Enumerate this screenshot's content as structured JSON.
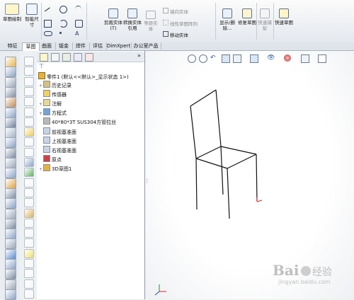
{
  "ribbon": {
    "sketch": "草图绘制",
    "smart_dim": "智能尺寸",
    "trim": "剪裁实体(T)",
    "convert": "转换实体引用",
    "offset": "等距实体",
    "mirror": "镜向实体",
    "linear_pattern": "线性草图阵列",
    "move": "移动实体",
    "show_delete": "显示/删除...",
    "repair": "修复草图",
    "quick_snap": "快速捕捉",
    "rapid_sketch": "快速草图"
  },
  "tabs": [
    "特征",
    "草图",
    "曲面",
    "钣金",
    "焊件",
    "评估",
    "DimXpert",
    "办公室产品"
  ],
  "active_tab": 1,
  "tree": {
    "root": "零件1 (默认<<默认>_显示状态 1>)",
    "items": [
      {
        "label": "历史记录",
        "expand": "+"
      },
      {
        "label": "传感器",
        "expand": ""
      },
      {
        "label": "注解",
        "expand": "+"
      },
      {
        "label": "方程式",
        "expand": "+"
      },
      {
        "label": "40*80*3T  SUS304方管拉丝",
        "expand": ""
      },
      {
        "label": "前视基准面",
        "expand": ""
      },
      {
        "label": "上视基准面",
        "expand": ""
      },
      {
        "label": "右视基准面",
        "expand": ""
      },
      {
        "label": "原点",
        "expand": ""
      },
      {
        "label": "3D草图1",
        "expand": "+"
      }
    ]
  },
  "watermark": {
    "brand": "Bai",
    "brand2": "经验",
    "url": "jingyan.baidu.com"
  },
  "colors": {
    "accent": "#2f5fa8",
    "tree_bg": "#ffffff",
    "gfx_bg": "#ffffff"
  }
}
